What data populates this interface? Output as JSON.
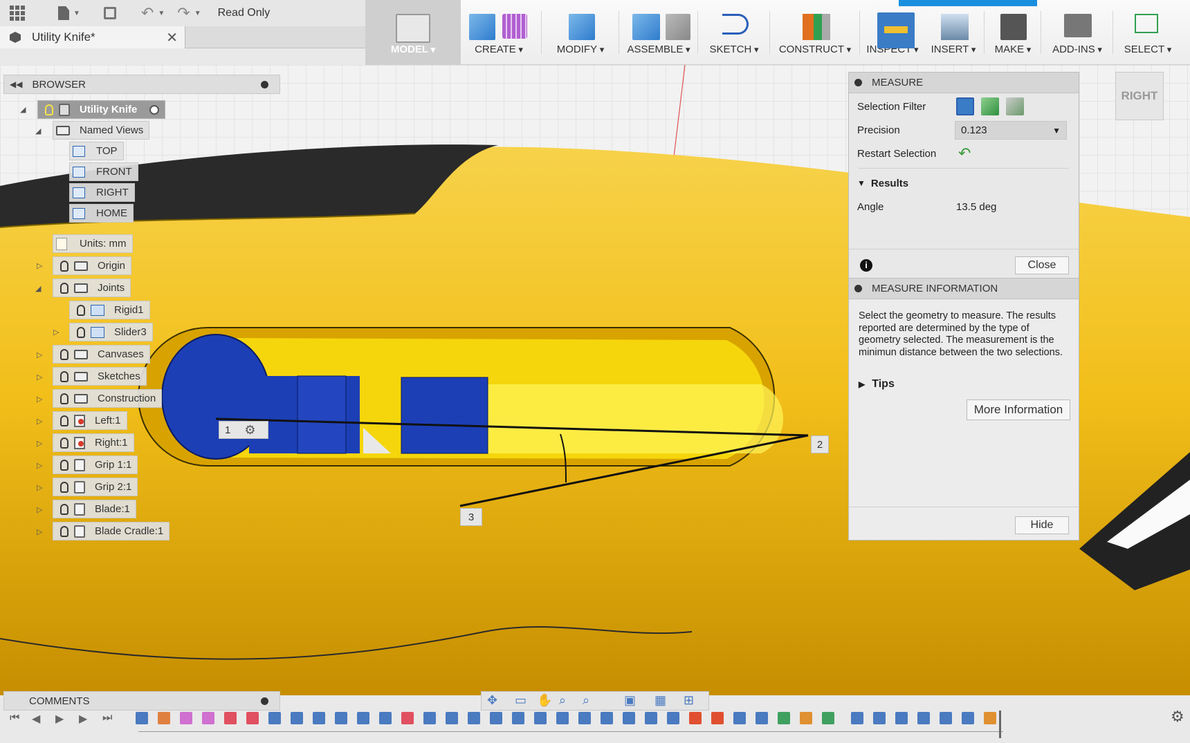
{
  "quickbar": {
    "read_only": "Read Only"
  },
  "document": {
    "title": "Utility Knife*",
    "close": "✕"
  },
  "ribbon": {
    "workspace": "MODEL",
    "groups": [
      "CREATE",
      "MODIFY",
      "ASSEMBLE",
      "SKETCH",
      "CONSTRUCT",
      "INSPECT",
      "INSERT",
      "MAKE",
      "ADD-INS",
      "SELECT"
    ]
  },
  "browser": {
    "title": "BROWSER",
    "root": "Utility Knife",
    "named_views": "Named Views",
    "views": [
      "TOP",
      "FRONT",
      "RIGHT",
      "HOME"
    ],
    "units": "Units: mm",
    "origin": "Origin",
    "joints": "Joints",
    "joint_items": [
      "Rigid1",
      "Slider3"
    ],
    "folders": [
      "Canvases",
      "Sketches",
      "Construction"
    ],
    "components": [
      "Left:1",
      "Right:1",
      "Grip 1:1",
      "Grip 2:1",
      "Blade:1",
      "Blade Cradle:1"
    ]
  },
  "measure": {
    "title": "MEASURE",
    "selection_filter": "Selection Filter",
    "precision_label": "Precision",
    "precision_value": "0.123",
    "restart": "Restart Selection",
    "results": "Results",
    "angle_label": "Angle",
    "angle_value": "13.5 deg",
    "close": "Close"
  },
  "measure_info": {
    "title": "MEASURE INFORMATION",
    "text": "Select the geometry to measure. The results reported are determined by the type of geometry selected. The measurement is the minimun distance between the two selections.",
    "tips": "Tips",
    "more": "More Information",
    "hide": "Hide"
  },
  "viewcube": "RIGHT",
  "points": [
    "1",
    "2",
    "3"
  ],
  "comments": "COMMENTS",
  "colors": {
    "body_yellow": "#f2bf1a",
    "insert_blue": "#1c3fb5",
    "accent": "#1a8fe0"
  }
}
